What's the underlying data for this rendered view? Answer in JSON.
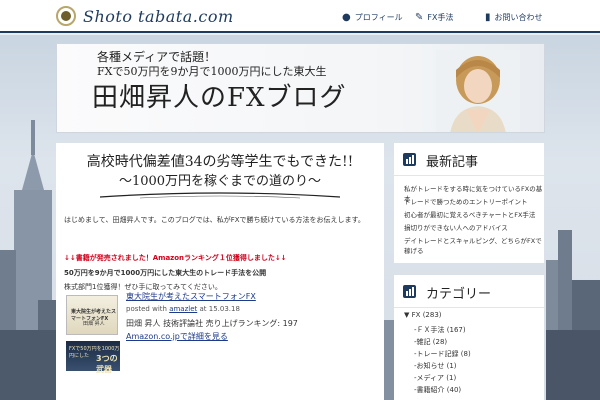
{
  "site": {
    "logo_text": "Shoto tabata.com"
  },
  "nav": {
    "items": [
      {
        "label": "プロフィール",
        "icon": "user-icon"
      },
      {
        "label": "FX手法",
        "icon": "pencil-icon"
      },
      {
        "label": "お問い合わせ",
        "icon": "chat-icon"
      }
    ]
  },
  "banner": {
    "line1": "各種メディアで話題！",
    "line2": "FXで50万円を9か月で1000万円にした東大生",
    "title": "田畑昇人のFXブログ"
  },
  "post": {
    "title_line1": "高校時代偏差値34の劣等学生でもできた!!",
    "title_line2": "～1000万円を稼ぐまでの道のり～",
    "intro": "はじめまして、田畑昇人です。このブログでは、私がFXで勝ち続けている方法をお伝えします。",
    "red_line": "↓↓書籍が発売されました！Amazonランキング１位獲得しました↓↓",
    "line2": "50万円を9か月で1000万円にした東大生のトレード手法を公開",
    "line3": "株式部門1位獲得！ぜひ手に取ってみてください。",
    "book1_caption": "東大院生が考えたスマートフォンFX",
    "book1_author": "田畑 昇人",
    "book2_text": "FXで50万円を1000万円にした",
    "book2_big": "3つの武器",
    "product_link": "東大院生が考えたスマートフォンFX",
    "posted_prefix": "posted with",
    "posted_author": "amazlet",
    "posted_suffix": "at 15.03.18",
    "rating_line": "田畑 昇人 技術評論社 売り上げランキング: 197",
    "amazon_link": "Amazon.co.jpで詳細を見る"
  },
  "sidebar": {
    "recent_title": "最新記事",
    "recent_items": [
      "私がトレードをする時に気をつけているFXの基本",
      "トレードで勝つためのエントリーポイント",
      "初心者が最初に覚えるべきチャートとFX手法",
      "損切りができない人へのアドバイス",
      "デイトレードとスキャルピング、どちらがFXで稼げる"
    ],
    "cats_title": "カテゴリー",
    "categories": [
      {
        "label": "FX",
        "count": "(283)",
        "arrow": "▼"
      },
      {
        "label": "-ＦＸ手法",
        "count": "(167)"
      },
      {
        "label": "-雑記",
        "count": "(28)"
      },
      {
        "label": "-トレード記録",
        "count": "(8)"
      },
      {
        "label": "-お知らせ",
        "count": "(1)"
      },
      {
        "label": "-メディア",
        "count": "(1)"
      },
      {
        "label": "-書籍紹介",
        "count": "(40)"
      }
    ]
  }
}
